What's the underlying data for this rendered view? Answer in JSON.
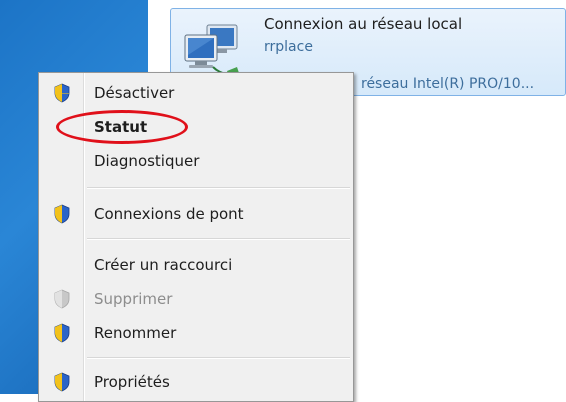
{
  "adapter": {
    "name": "Connexion au réseau local",
    "subtitle": "rrplace",
    "device": "réseau Intel(R) PRO/10...",
    "icon": "network-adapter-icon"
  },
  "menu": {
    "items": [
      {
        "label": "Désactiver",
        "icon": "shield-icon",
        "style": "normal"
      },
      {
        "label": "Statut",
        "icon": "",
        "style": "bold"
      },
      {
        "label": "Diagnostiquer",
        "icon": "",
        "style": "normal"
      },
      {
        "label": "Connexions de pont",
        "icon": "shield-icon",
        "style": "normal"
      },
      {
        "label": "Créer un raccourci",
        "icon": "",
        "style": "normal"
      },
      {
        "label": "Supprimer",
        "icon": "shield-icon",
        "style": "disabled"
      },
      {
        "label": "Renommer",
        "icon": "shield-icon",
        "style": "normal"
      },
      {
        "label": "Propriétés",
        "icon": "shield-icon",
        "style": "normal"
      }
    ]
  },
  "annotation": {
    "color": "#e0101a",
    "shape": "red ellipse around Statut"
  },
  "colors": {
    "desktop": "#1c74c6",
    "selection": "#d6e9fa",
    "menu_bg": "#f0f0f0"
  }
}
